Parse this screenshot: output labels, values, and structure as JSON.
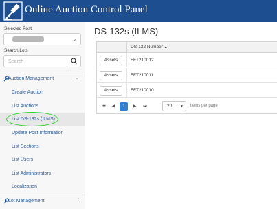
{
  "header": {
    "title": "Online Auction Control Panel"
  },
  "sidebar": {
    "selected_post_label": "Selected Post",
    "search_lots_label": "Search Lots",
    "search_placeholder": "Search",
    "menu": {
      "auction_management": "Auction Management",
      "create_auction": "Create Auction",
      "list_auctions": "List Auctions",
      "list_ds132s": "List DS-132s (ILMS)",
      "update_post": "Update Post Information",
      "list_sections": "List Sections",
      "list_users": "List Users",
      "list_admins": "List Administrators",
      "localization": "Localization",
      "lot_management": "Lot Management"
    }
  },
  "main": {
    "title": "DS-132s (ILMS)",
    "grid": {
      "column_header": "DS-132 Number",
      "sort_indicator": "▲",
      "rows": [
        {
          "action": "Assets",
          "number": "FFT210012"
        },
        {
          "action": "Assets",
          "number": "FFT210011"
        },
        {
          "action": "Assets",
          "number": "FFT210010"
        }
      ],
      "pager": {
        "first": "⏮",
        "prev": "◀",
        "current_page": "1",
        "next": "▶",
        "last": "⏭",
        "page_size": "20",
        "page_size_caret": "▼",
        "per_page_label": "items per page"
      }
    }
  },
  "colors": {
    "header_bg": "#1d4e8f",
    "link": "#2a5d9f",
    "page_active": "#2f7fd2",
    "highlight_circle": "#2ad02a"
  },
  "icons": [
    "gavel-logo-icon",
    "search-icon",
    "wrench-icon",
    "chevron-down-icon",
    "chevron-left-icon"
  ]
}
